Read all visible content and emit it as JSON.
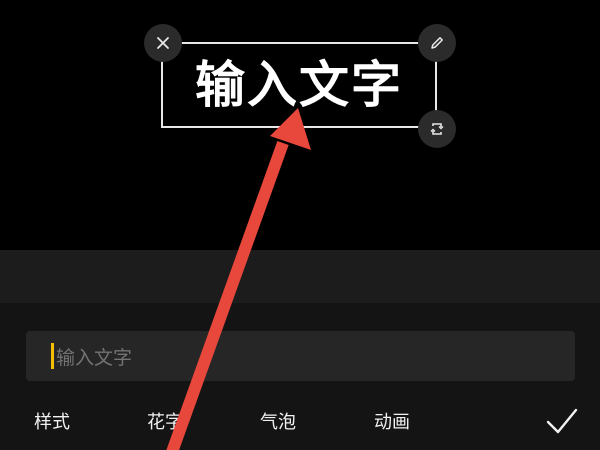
{
  "canvas": {
    "overlay_text": "输入文字",
    "handles": [
      "close-icon",
      "pencil-icon",
      "rotate-icon"
    ]
  },
  "editor": {
    "input_placeholder": "输入文字",
    "caret_color": "#f5c000"
  },
  "tabs": [
    {
      "label": "样式"
    },
    {
      "label": "花字"
    },
    {
      "label": "气泡"
    },
    {
      "label": "动画"
    }
  ],
  "confirm": {
    "icon": "checkmark-icon"
  },
  "annotation": {
    "arrow_color": "#e8473b"
  }
}
